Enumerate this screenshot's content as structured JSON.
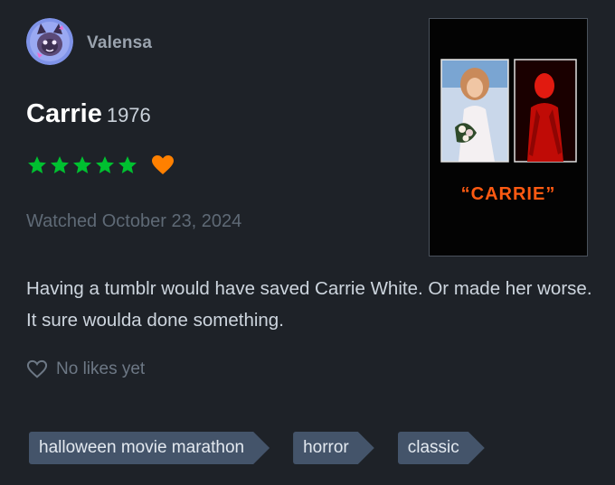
{
  "user": {
    "name": "Valensa",
    "avatar_icon": "avatar-creature-icon"
  },
  "film": {
    "title": "Carrie",
    "year": "1976"
  },
  "rating": {
    "stars": 5,
    "max": 5,
    "liked": true,
    "star_color": "#00c030",
    "heart_color": "#ff8000"
  },
  "watched": "Watched October 23, 2024",
  "review": "Having a tumblr would have saved Carrie White. Or made her worse. It sure woulda done something.",
  "likes": {
    "label": "No likes yet",
    "icon": "heart-outline-icon"
  },
  "tags": [
    "halloween movie marathon",
    "horror",
    "classic"
  ],
  "poster": {
    "title_text": "“CARRIE”"
  },
  "colors": {
    "background": "#1e2228",
    "tag": "#44546a"
  }
}
